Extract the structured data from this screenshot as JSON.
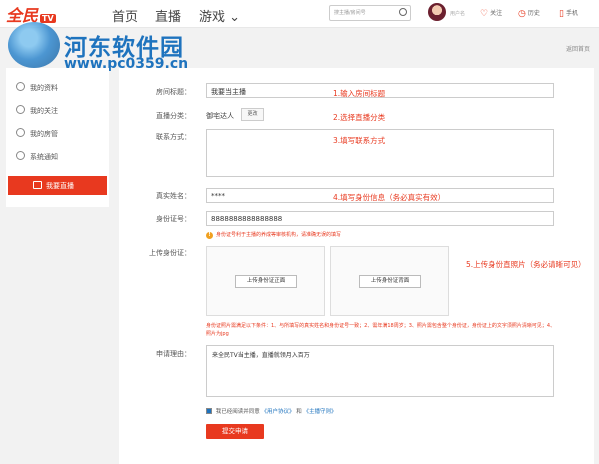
{
  "header": {
    "logo": "全民",
    "logo_tag": "TV",
    "nav": [
      "首页",
      "直播",
      "游戏 ⌄"
    ],
    "search_placeholder": "搜主播/房间号",
    "user_name": "用户名",
    "follow": "关注",
    "history": "历史",
    "phone": "手机"
  },
  "watermark": {
    "text": "河东软件园",
    "url": "www.pc0359.cn"
  },
  "back_home": "返回首页",
  "sidebar": {
    "items": [
      "我的资料",
      "我的关注",
      "我的房管",
      "系统通知"
    ],
    "active": "我要直播"
  },
  "form": {
    "room_title_label": "房间标题：",
    "room_title_value": "我要当主播",
    "category_label": "直播分类：",
    "category_value": "御宅达人",
    "change_label": "更改",
    "contact_label": "联系方式：",
    "real_name_label": "真实姓名：",
    "real_name_value": "****",
    "id_label": "身份证号：",
    "id_value": "8888888888888888",
    "id_hint": "身份证号利于主播的养成等审核机构，请准确无误的填写",
    "upload_label": "上传身份证：",
    "upload_front": "上传身份证正面",
    "upload_back": "上传身份证背面",
    "upload_desc": "身份证照片需满足以下条件：1、与所填写的真实姓名和身份证号一致；2、需年满18周岁；3、照片需包含整个身份证，身份证上的文字须照片清晰可见；4、照片为jpg",
    "reason_label": "申请理由：",
    "reason_value": "来全民TV当主播，直播就领月入百万",
    "agree_text": "我已经阅读并同意",
    "agree_link1": "《用户协议》",
    "agree_and": "和",
    "agree_link2": "《主播守则》",
    "submit": "提交申请"
  },
  "notes": {
    "n1": "1.输入房间标题",
    "n2": "2.选择直播分类",
    "n3": "3.填写联系方式",
    "n4": "4.填写身份信息（务必真实有效）",
    "n5": "5.上传身份直照片（务必请晰可见）"
  }
}
